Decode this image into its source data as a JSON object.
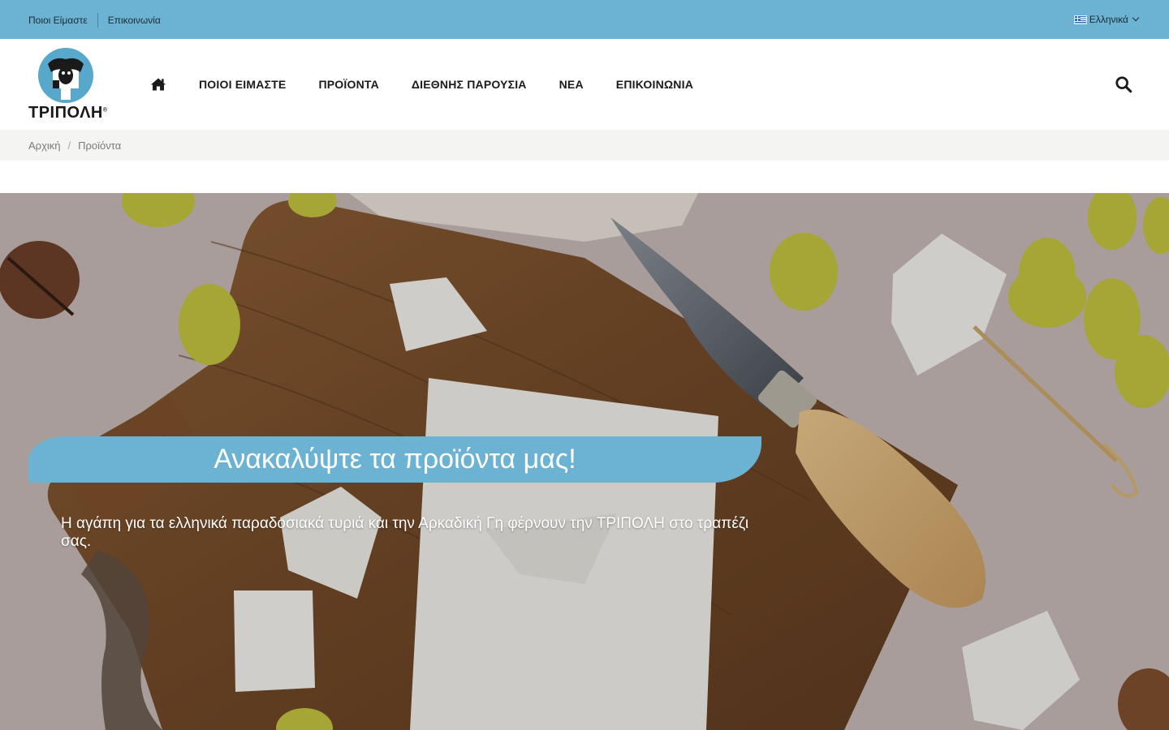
{
  "topbar": {
    "links": [
      "Ποιοι Είμαστε",
      "Επικοινωνία"
    ],
    "language": "Ελληνικά",
    "flag_icon": "greek-flag-icon"
  },
  "header": {
    "logo_text": "ΤΡΙΠΟΛΗ",
    "logo_mark": "®",
    "nav": [
      "ΠΟΙΟΙ ΕΙΜΑΣΤΕ",
      "ΠΡΟΪΟΝΤΑ",
      "ΔΙΕΘΝΗΣ ΠΑΡΟΥΣΙΑ",
      "ΝΕΑ",
      "ΕΠΙΚΟΙΝΩΝΙΑ"
    ],
    "home_icon": "home-icon",
    "search_icon": "search-icon"
  },
  "breadcrumb": [
    "Αρχική",
    "Προϊόντα"
  ],
  "hero": {
    "title": "Ανακαλύψτε τα προϊόντα μας!",
    "text": "Η αγάπη για τα ελληνικά παραδοσιακά τυριά και την Αρκαδική Γη φέρνουν την ΤΡΙΠΟΛΗ στο τραπέζι σας."
  },
  "colors": {
    "accent": "#6cb3d3",
    "logo_blue": "#58a8cc",
    "text_dark": "#1a1a1a",
    "breadcrumb_bg": "#f4f5f3"
  }
}
